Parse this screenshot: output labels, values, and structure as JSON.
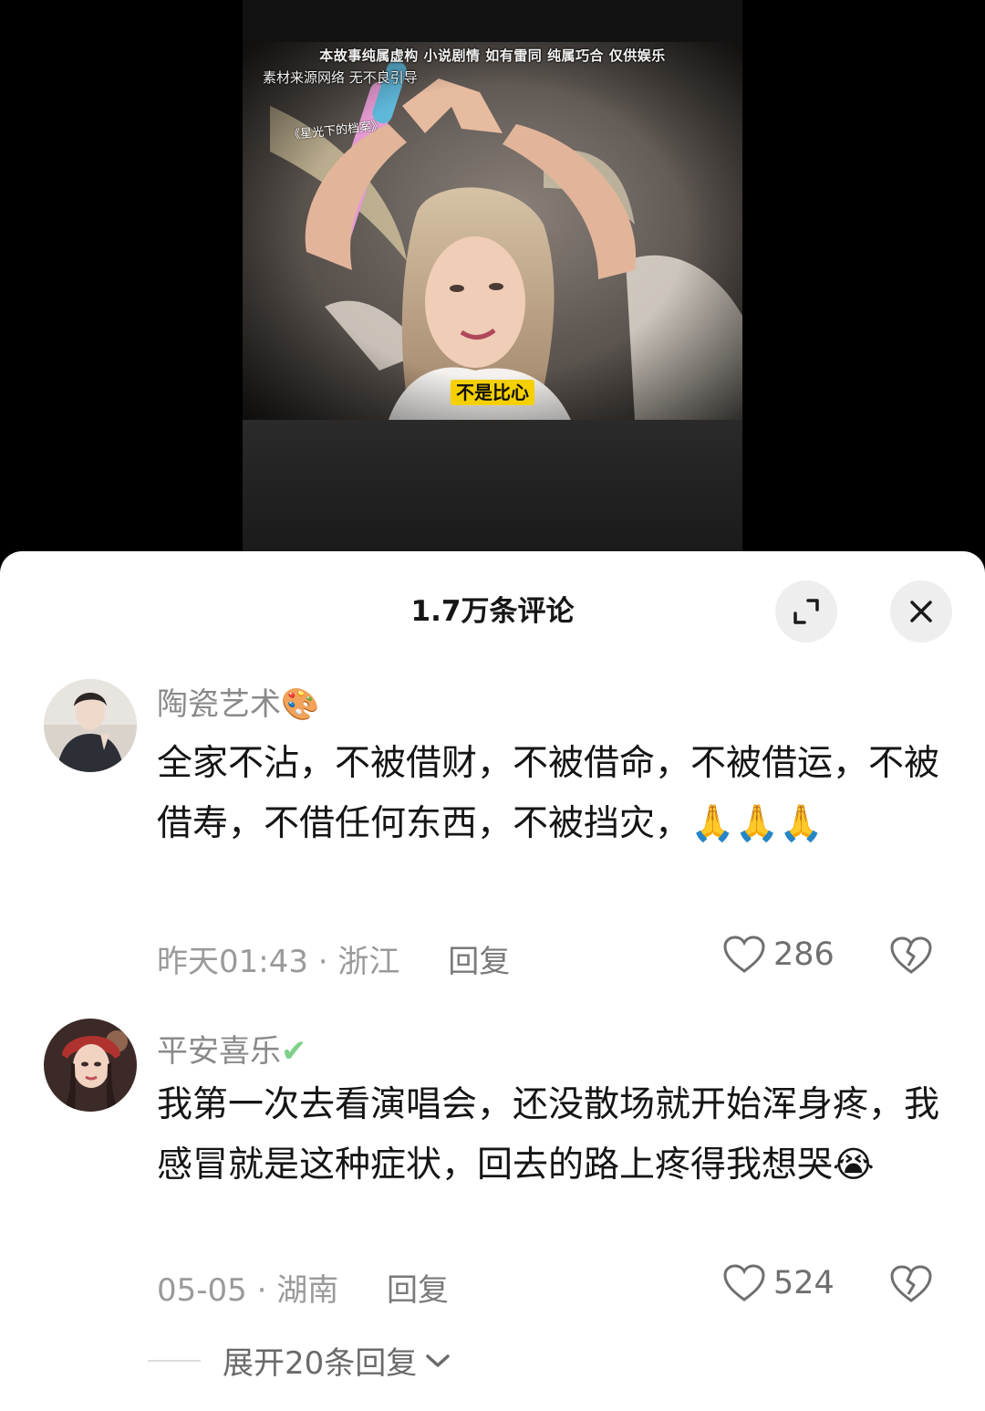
{
  "video": {
    "disclaimer": "本故事纯属虚构 小说剧情 如有雷同 纯属巧合 仅供娱乐",
    "source_note": "素材来源网络 无不良引导",
    "watermark": "《星光下的档案》",
    "subtitle": "不是比心"
  },
  "comments_panel": {
    "title": "1.7万条评论",
    "expand_icon": "expand-icon",
    "close_icon": "close-icon"
  },
  "comments": [
    {
      "username": "陶瓷艺术",
      "username_emoji": "🎨",
      "text": "全家不沾，不被借财，不被借命，不被借运，不被借寿，不借任何东西，不被挡灾，🙏🙏🙏",
      "time": "昨天01:43",
      "separator": "·",
      "location": "浙江",
      "reply_label": "回复",
      "likes": "286"
    },
    {
      "username": "平安喜乐",
      "username_emoji": "✔",
      "text": "我第一次去看演唱会，还没散场就开始浑身疼，我感冒就是这种症状，回去的路上疼得我想哭😭",
      "time": "05-05",
      "separator": "·",
      "location": "湖南",
      "reply_label": "回复",
      "likes": "524",
      "expand_replies_label": "展开20条回复"
    }
  ],
  "colors": {
    "sheet_bg": "#ffffff",
    "text_primary": "#151515",
    "text_secondary": "#9a9a9a",
    "verified_green": "#7ed08a",
    "subtitle_yellow": "#f5d000"
  }
}
